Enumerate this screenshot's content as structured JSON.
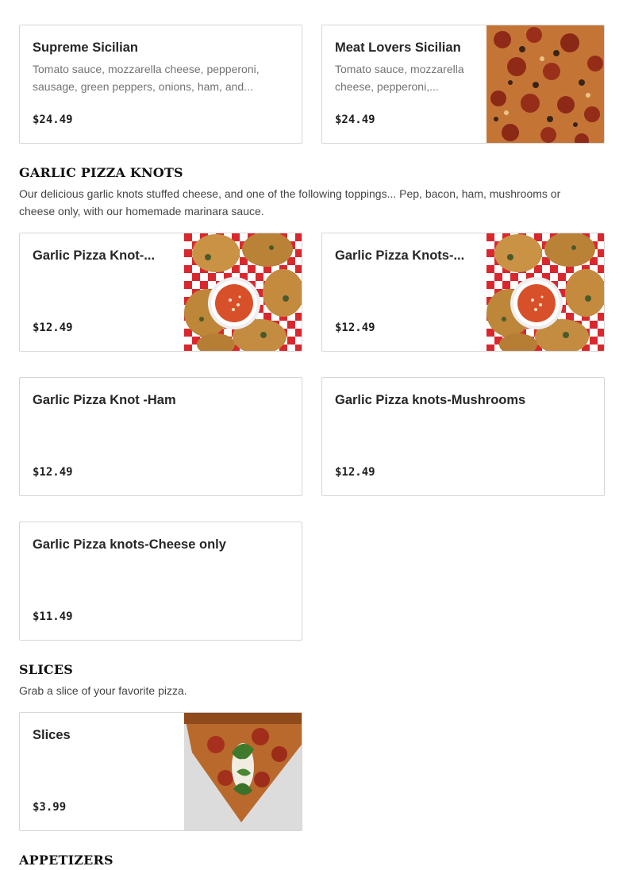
{
  "sicilian_items": [
    {
      "name": "Supreme Sicilian",
      "description": "Tomato sauce, mozzarella cheese, pepperoni, sausage, green peppers, onions, ham, and...",
      "price": "$24.49"
    },
    {
      "name": "Meat Lovers Sicilian",
      "description": "Tomato sauce, mozzarella cheese, pepperoni,...",
      "price": "$24.49",
      "image": "meat-lovers-pizza-photo"
    }
  ],
  "sections": {
    "garlic_knots": {
      "title": "GARLIC PIZZA KNOTS",
      "description": "Our delicious garlic knots stuffed cheese, and one of the following toppings... Pep, bacon, ham, mushrooms or cheese only, with our homemade marinara sauce.",
      "items": [
        {
          "name": "Garlic Pizza Knot-...",
          "price": "$12.49",
          "image": "garlic-knots-photo"
        },
        {
          "name": "Garlic Pizza Knots-...",
          "price": "$12.49",
          "image": "garlic-knots-photo"
        },
        {
          "name": "Garlic Pizza Knot -Ham",
          "price": "$12.49"
        },
        {
          "name": "Garlic Pizza knots-Mushrooms",
          "price": "$12.49"
        },
        {
          "name": "Garlic Pizza knots-Cheese only",
          "price": "$11.49"
        }
      ]
    },
    "slices": {
      "title": "SLICES",
      "description": "Grab a slice of your favorite pizza.",
      "items": [
        {
          "name": "Slices",
          "price": "$3.99",
          "image": "pizza-slice-photo"
        }
      ]
    },
    "appetizers": {
      "title": "APPETIZERS"
    }
  },
  "colors": {
    "card_border": "#d6d6d6",
    "title_text": "#111111",
    "description_text": "#737373"
  }
}
